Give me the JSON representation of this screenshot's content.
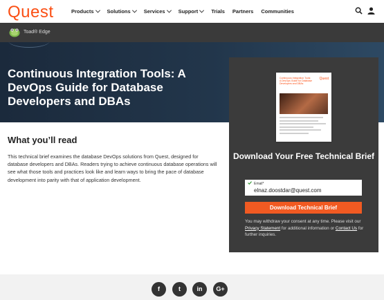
{
  "header": {
    "logo": "Quest",
    "nav": [
      {
        "label": "Products",
        "dropdown": true
      },
      {
        "label": "Solutions",
        "dropdown": true
      },
      {
        "label": "Services",
        "dropdown": true
      },
      {
        "label": "Support",
        "dropdown": true
      },
      {
        "label": "Trials",
        "dropdown": false
      },
      {
        "label": "Partners",
        "dropdown": false
      },
      {
        "label": "Communities",
        "dropdown": false
      }
    ],
    "icons": [
      "search-icon",
      "user-icon"
    ]
  },
  "product_bar": {
    "product_name": "Toad® Edge",
    "icon": "toad-icon"
  },
  "hero": {
    "title": "Continuous Integration Tools: A DevOps Guide for Database Developers and DBAs"
  },
  "main": {
    "heading": "What you’ll read",
    "description": "This technical brief examines the database DevOps solutions from Quest, designed for database developers and DBAs. Readers trying to achieve continuous database operations will see what those tools and practices look like and learn ways to bring the pace of database development into parity with that of application development."
  },
  "form": {
    "cover": {
      "title": "Continuous Integration Tools: A DevOps Guide for Database Developers and DBAs",
      "logo": "Quest"
    },
    "heading": "Download Your Free Technical Brief",
    "email_label": "Email*",
    "email_value": "elnaz.doostdar@quest.com",
    "button_label": "Download Technical Brief",
    "consent": {
      "prefix": "You may withdraw your consent at any time. Please visit our ",
      "privacy_link": "Privacy Statement",
      "middle": " for additional information or ",
      "contact_link": "Contact Us",
      "suffix": " for further inquiries."
    }
  },
  "footer": {
    "social": [
      {
        "name": "facebook-icon",
        "glyph": "f"
      },
      {
        "name": "twitter-icon",
        "glyph": "t"
      },
      {
        "name": "linkedin-icon",
        "glyph": "in"
      },
      {
        "name": "googleplus-icon",
        "glyph": "G+"
      }
    ]
  },
  "colors": {
    "brand_orange": "#fb4f14",
    "button_orange": "#f15a22",
    "panel_bg": "#3b3b3b",
    "hero_bg": "#1b2a3c"
  }
}
